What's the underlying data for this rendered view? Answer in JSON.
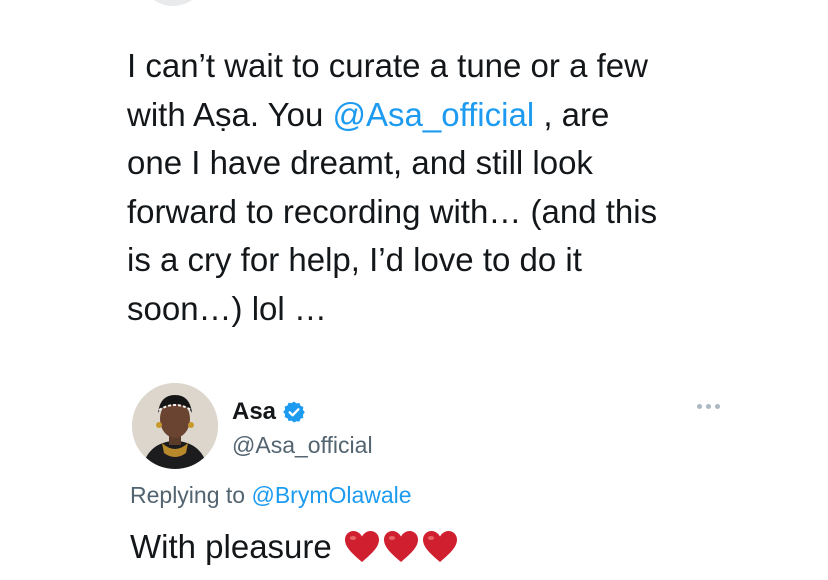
{
  "tweet": {
    "lines": [
      {
        "parts": [
          {
            "t": "I can’t wait to curate a tune or a few",
            "m": false
          }
        ]
      },
      {
        "parts": [
          {
            "t": "with Aṣa. You ",
            "m": false
          },
          {
            "t": "@Asa_official",
            "m": true
          },
          {
            "t": " , are",
            "m": false
          }
        ]
      },
      {
        "parts": [
          {
            "t": "one I have dreamt, and still look",
            "m": false
          }
        ]
      },
      {
        "parts": [
          {
            "t": "forward to recording with… (and this",
            "m": false
          }
        ]
      },
      {
        "parts": [
          {
            "t": "is a cry for help, I’d love to do it",
            "m": false
          }
        ]
      },
      {
        "parts": [
          {
            "t": "soon…) lol …",
            "m": false
          }
        ]
      }
    ]
  },
  "reply": {
    "display_name": "Asa",
    "handle": "@Asa_official",
    "replying_prefix": "Replying to ",
    "replying_to": "@BrymOlawale",
    "text": "With pleasure",
    "icons": {
      "verified": "verified-badge-icon",
      "more": "more-options-icon",
      "emoji": "red-heart-icon",
      "emoji_count": 3
    }
  },
  "colors": {
    "link": "#1d9bf0",
    "text": "#14171a",
    "muted": "#536471",
    "heart": "#d01f2f"
  }
}
